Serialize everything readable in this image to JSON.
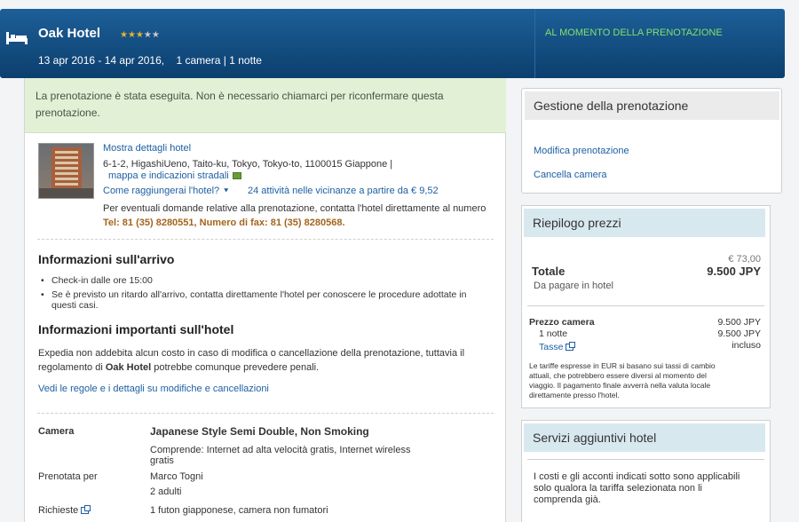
{
  "header": {
    "hotel_name": "Oak Hotel",
    "stars_filled": "★★★",
    "stars_empty": "★★",
    "dates": "13 apr 2016 - 14 apr 2016,    1 camera | 1 notte",
    "at_booking": "AL MOMENTO DELLA PRENOTAZIONE"
  },
  "banner": {
    "line1": "La prenotazione è stata eseguita. Non è necessario chiamarci per riconfermare questa",
    "line2": "prenotazione."
  },
  "hotel": {
    "show_details": "Mostra dettagli hotel",
    "address": "6-1-2, HigashiUeno, Taito-ku, Tokyo, Tokyo-to, 1100015 Giappone  |",
    "map_link": "mappa e indicazioni stradali",
    "how_reach": "Come raggiungerai l'hotel?",
    "activities": "24 attività nelle vicinanze a partire da € 9,52",
    "contact": "Per eventuali domande relative alla prenotazione, contatta l'hotel direttamente al numero",
    "phone": "Tel: 81 (35) 8280551, Numero di fax: 81 (35) 8280568."
  },
  "arrival": {
    "title": "Informazioni sull'arrivo",
    "item1": "Check-in dalle ore 15:00",
    "item2a": "Se è previsto un ritardo all'arrivo, contatta direttamente l'hotel per conoscere le procedure adottate in",
    "item2b": "questi casi."
  },
  "important": {
    "title": "Informazioni importanti sull'hotel",
    "p1a": "Expedia non addebita alcun costo in caso di modifica o cancellazione della prenotazione, tuttavia il",
    "p1b_pre": "regolamento di ",
    "p1b_hotel": "Oak Hotel",
    "p1b_post": " potrebbe comunque prevedere penali.",
    "rules_link": "Vedi le regole e i dettagli su modifiche e cancellazioni"
  },
  "room": {
    "camera_label": "Camera",
    "camera_value": "Japanese Style Semi Double, Non Smoking",
    "includes_a": "Comprende: Internet ad alta velocità gratis, Internet wireless",
    "includes_b": "gratis",
    "booked_label": "Prenotata per",
    "guest": "Marco Togni",
    "adults": "2 adulti",
    "requests_label": "Richieste",
    "requests_value": "1 futon giapponese, camera non fumatori"
  },
  "manage": {
    "title": "Gestione della prenotazione",
    "modify": "Modifica prenotazione",
    "cancel": "Cancella camera"
  },
  "prices": {
    "title": "Riepilogo prezzi",
    "eur": "€ 73,00",
    "total_label": "Totale",
    "total_value": "9.500 JPY",
    "pay_at_hotel": "Da pagare in hotel",
    "room_price_label": "Prezzo camera",
    "room_price_value": "9.500 JPY",
    "night_label": "1 notte",
    "night_value": "9.500 JPY",
    "taxes_label": "Tasse",
    "taxes_value": "incluso",
    "note1": "Le tariffe espresse in EUR si basano sui tassi di cambio",
    "note2": "attuali, che potrebbero essere diversi al momento del",
    "note3": "viaggio. Il pagamento finale avverrà nella valuta locale",
    "note4": "direttamente presso l'hotel."
  },
  "services": {
    "title": "Servizi aggiuntivi hotel",
    "l1": "I costi e gli acconti indicati sotto sono applicabili",
    "l2": "solo qualora la tariffa selezionata non li",
    "l3": "comprenda già."
  }
}
